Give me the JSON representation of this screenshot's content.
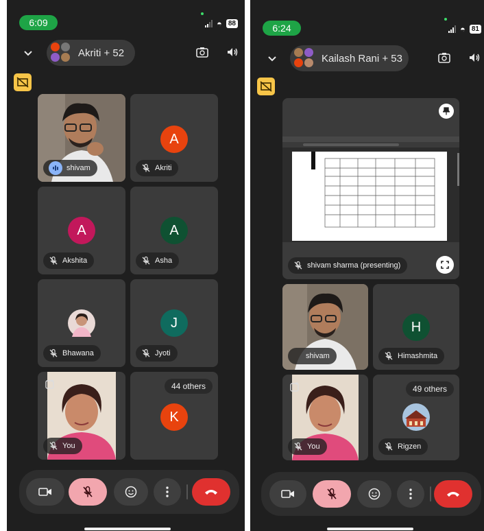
{
  "left": {
    "time": "6:09",
    "battery": "88",
    "call_title": "Akriti + 52",
    "tiles": [
      {
        "name": "shivam",
        "state": "speaking"
      },
      {
        "name": "Akriti",
        "letter": "A",
        "color": "#e8430e"
      },
      {
        "name": "Akshita",
        "letter": "A",
        "color": "#c2185b"
      },
      {
        "name": "Asha",
        "letter": "A",
        "color": "#0f5132"
      },
      {
        "name": "Bhawana"
      },
      {
        "name": "Jyoti",
        "letter": "J",
        "color": "#0f6b5e"
      },
      {
        "name": "You"
      },
      {
        "name": "",
        "letter": "K",
        "color": "#e8430e",
        "others": "44 others"
      }
    ]
  },
  "right": {
    "time": "6:24",
    "battery": "81",
    "call_title": "Kailash Rani + 53",
    "presenter_label": "shivam sharma (presenting)",
    "tiles": [
      {
        "name": "shivam"
      },
      {
        "name": "Himashmita",
        "letter": "H",
        "color": "#0f5132"
      },
      {
        "name": "You"
      },
      {
        "name": "Rigzen",
        "others": "49 others"
      }
    ]
  },
  "colors": {
    "mic_muted": "#f2a6ae",
    "end_call": "#e0312f",
    "time_pill": "#1ea446",
    "tile_bg": "#3b3b3b"
  }
}
